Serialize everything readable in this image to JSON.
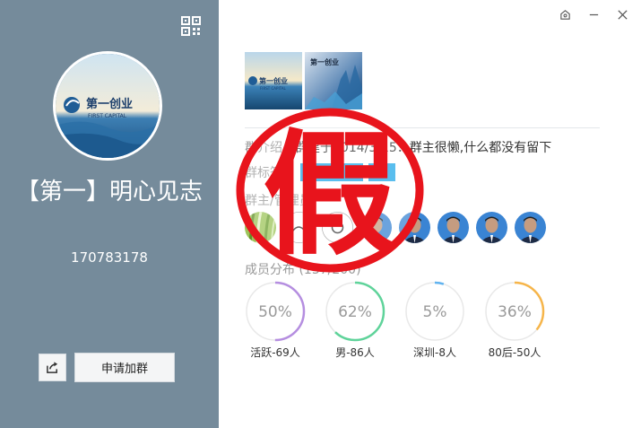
{
  "left_panel": {
    "group_name": "【第一】明心见志",
    "group_id": "170783178",
    "apply_button_label": "申请加群",
    "logo_text_cn": "第一创业",
    "logo_text_en": "FIRST CAPITAL"
  },
  "right_panel": {
    "intro_label": "群介绍：",
    "intro_text": "群建于2014/3/15：群主很懒,什么都没有留下",
    "tags_label": "群标签：",
    "tags": [
      "",
      ""
    ],
    "admin_label": "群主/管理员",
    "member_distribution_label": "成员分布",
    "member_distribution_count": "(137/200)",
    "photo_logo_cn": "第一创业",
    "photo_logo_en": "FIRST CAPITAL",
    "stats": [
      {
        "percent": "50%",
        "fraction": 0.5,
        "label": "活跃-69人",
        "color": "#b58ee0"
      },
      {
        "percent": "62%",
        "fraction": 0.62,
        "label": "男-86人",
        "color": "#5fd39a"
      },
      {
        "percent": "5%",
        "fraction": 0.05,
        "label": "深圳-8人",
        "color": "#61b3ef"
      },
      {
        "percent": "36%",
        "fraction": 0.36,
        "label": "80后-50人",
        "color": "#f6b54a"
      }
    ]
  },
  "stamp_text": "假",
  "colors": {
    "left_bg": "#758b9b",
    "stamp_red": "#e8141c",
    "tag_blue": "#23a8e8"
  }
}
